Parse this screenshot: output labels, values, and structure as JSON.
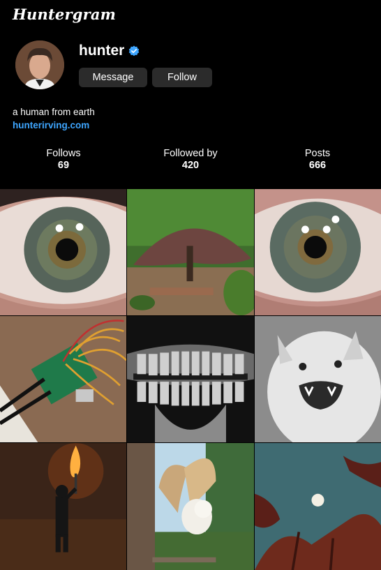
{
  "app": {
    "logo_text": "Huntergram"
  },
  "profile": {
    "username": "hunter",
    "verified": true,
    "bio": "a human from earth",
    "link": "hunterirving.com"
  },
  "actions": {
    "message_label": "Message",
    "follow_label": "Follow"
  },
  "stats": [
    {
      "label": "Follows",
      "value": "69"
    },
    {
      "label": "Followed by",
      "value": "420"
    },
    {
      "label": "Posts",
      "value": "666"
    }
  ],
  "posts": [
    {
      "subject": "eye-close-up"
    },
    {
      "subject": "weeping-tree-garden"
    },
    {
      "subject": "eye-close-up"
    },
    {
      "subject": "raspberry-pi-wires"
    },
    {
      "subject": "dental-xray"
    },
    {
      "subject": "snarling-dog"
    },
    {
      "subject": "person-with-torch"
    },
    {
      "subject": "barn-owl-flying"
    },
    {
      "subject": "moon-red-leaves"
    }
  ],
  "colors": {
    "accent": "#3ea6ff",
    "button_bg": "#2b2b2b",
    "background": "#000000"
  }
}
